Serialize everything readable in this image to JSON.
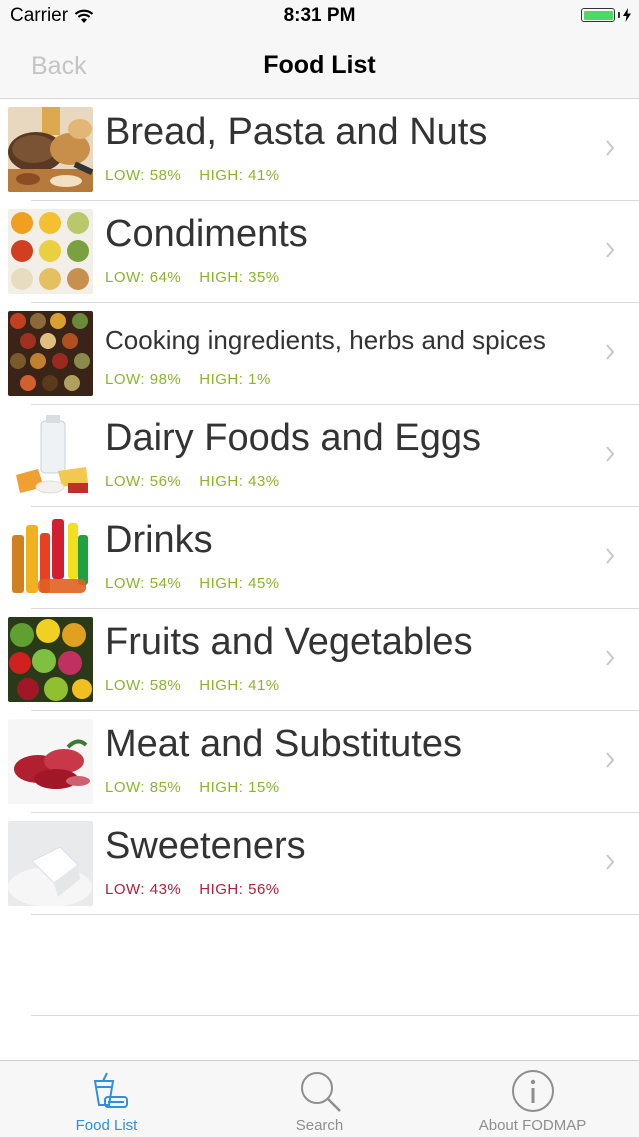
{
  "status_bar": {
    "carrier": "Carrier",
    "time": "8:31 PM"
  },
  "nav": {
    "back_label": "Back",
    "title": "Food List"
  },
  "categories": [
    {
      "title": "Bread, Pasta and Nuts",
      "low": "LOW: 58%",
      "high": "HIGH: 41%",
      "tone": "green",
      "image": "bread-image"
    },
    {
      "title": "Condiments",
      "low": "LOW: 64%",
      "high": "HIGH: 35%",
      "tone": "green",
      "image": "condiments-image"
    },
    {
      "title": "Cooking ingredients, herbs and spices",
      "low": "LOW: 98%",
      "high": "HIGH: 1%",
      "tone": "green",
      "image": "spices-image"
    },
    {
      "title": "Dairy Foods and Eggs",
      "low": "LOW: 56%",
      "high": "HIGH: 43%",
      "tone": "green",
      "image": "dairy-image"
    },
    {
      "title": "Drinks",
      "low": "LOW: 54%",
      "high": "HIGH: 45%",
      "tone": "green",
      "image": "drinks-image"
    },
    {
      "title": "Fruits and Vegetables",
      "low": "LOW: 58%",
      "high": "HIGH: 41%",
      "tone": "green",
      "image": "fruits-image"
    },
    {
      "title": "Meat and Substitutes",
      "low": "LOW: 85%",
      "high": "HIGH: 15%",
      "tone": "green",
      "image": "meat-image"
    },
    {
      "title": "Sweeteners",
      "low": "LOW: 43%",
      "high": "HIGH: 56%",
      "tone": "red",
      "image": "sugar-image"
    }
  ],
  "tabs": [
    {
      "label": "Food List",
      "icon": "food-list-icon",
      "active": true
    },
    {
      "label": "Search",
      "icon": "search-icon",
      "active": false
    },
    {
      "label": "About FODMAP",
      "icon": "info-icon",
      "active": false
    }
  ],
  "colors": {
    "low_green": "#8ab42e",
    "high_red": "#b0203a",
    "tint": "#2f8fe0"
  }
}
